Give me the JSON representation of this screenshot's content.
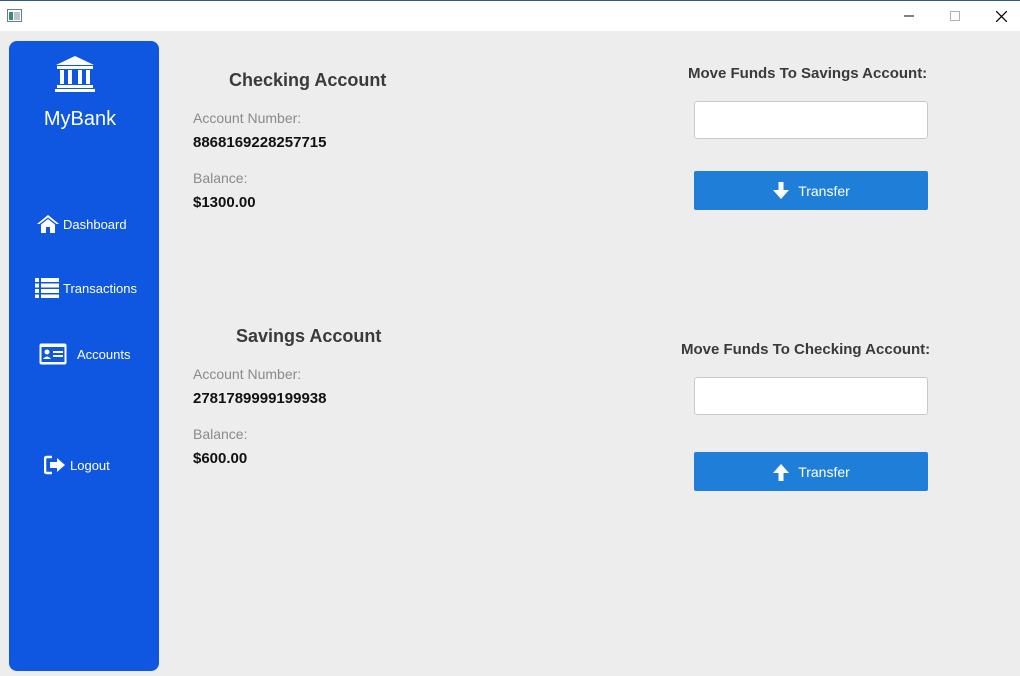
{
  "window": {
    "icons": {
      "app": "app-window-icon",
      "minimize": "minimize-icon",
      "maximize": "maximize-icon",
      "close": "close-icon"
    }
  },
  "sidebar": {
    "brand": "MyBank",
    "logo_icon": "bank-icon",
    "items": [
      {
        "label": "Dashboard",
        "icon": "home-icon"
      },
      {
        "label": "Transactions",
        "icon": "list-icon"
      },
      {
        "label": "Accounts",
        "icon": "id-card-icon"
      }
    ],
    "logout": {
      "label": "Logout",
      "icon": "logout-icon"
    },
    "color": "#0f57e0"
  },
  "checking": {
    "title": "Checking Account",
    "account_number_label": "Account Number:",
    "account_number": "8868169228257715",
    "balance_label": "Balance:",
    "balance": "$1300.00"
  },
  "savings": {
    "title": "Savings Account",
    "account_number_label": "Account Number:",
    "account_number": "2781789999199938",
    "balance_label": "Balance:",
    "balance": "$600.00"
  },
  "to_savings": {
    "label": "Move Funds To Savings Account:",
    "input_value": "",
    "button_label": "Transfer",
    "button_icon": "arrow-down-icon"
  },
  "to_checking": {
    "label": "Move Funds To Checking Account:",
    "input_value": "",
    "button_label": "Transfer",
    "button_icon": "arrow-up-icon"
  },
  "colors": {
    "accent": "#1f7fd8",
    "background": "#ededed"
  }
}
